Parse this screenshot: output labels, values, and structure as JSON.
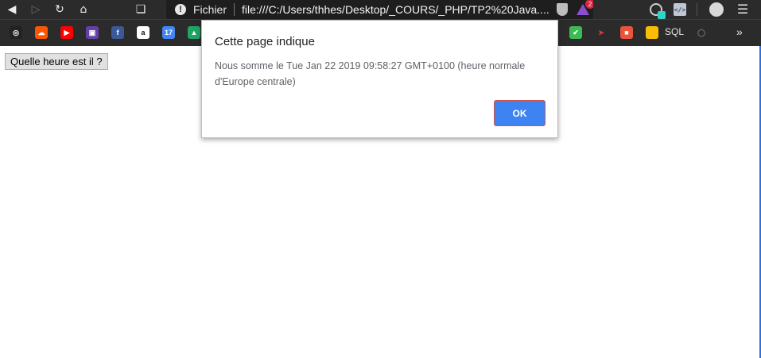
{
  "browser": {
    "omnibox": {
      "scheme_label": "Fichier",
      "url": "file:///C:/Users/thhes/Desktop/_COURS/_PHP/TP2%20Java....",
      "extension_badge_count": "2"
    },
    "bookmarks": [
      {
        "name": "steam",
        "color": "#222222",
        "glyph": "◎"
      },
      {
        "name": "soundcloud",
        "color": "#ff5500",
        "glyph": "☁"
      },
      {
        "name": "youtube",
        "color": "#ff0000",
        "glyph": "▶"
      },
      {
        "name": "twitch",
        "color": "#6441a5",
        "glyph": "▣"
      },
      {
        "name": "facebook",
        "color": "#3b5998",
        "glyph": "f"
      },
      {
        "name": "amazon",
        "color": "#ffffff",
        "glyph": "a"
      },
      {
        "name": "calendar",
        "color": "#4285f4",
        "glyph": "17"
      },
      {
        "name": "drive",
        "color": "#1fa463",
        "glyph": "▲"
      },
      {
        "name": "check-ext",
        "color": "#3cba54",
        "glyph": "✔"
      },
      {
        "name": "arrow-ext",
        "color": "#2b2b2b",
        "glyph": "➤"
      },
      {
        "name": "office",
        "color": "#e8543c",
        "glyph": "■"
      },
      {
        "name": "keep",
        "color": "#fbbc05",
        "glyph": ""
      },
      {
        "name": "circle-ext",
        "color": "#4a4a4a",
        "glyph": "◯"
      }
    ],
    "bookmark_sql_label": "SQL",
    "more_label": "»"
  },
  "page": {
    "button_label": "Quelle heure est il ?"
  },
  "dialog": {
    "title": "Cette page indique",
    "message": "Nous somme le Tue Jan 22 2019 09:58:27 GMT+0100 (heure normale d'Europe centrale)",
    "ok_label": "OK",
    "ok_color": "#3d83f2"
  }
}
